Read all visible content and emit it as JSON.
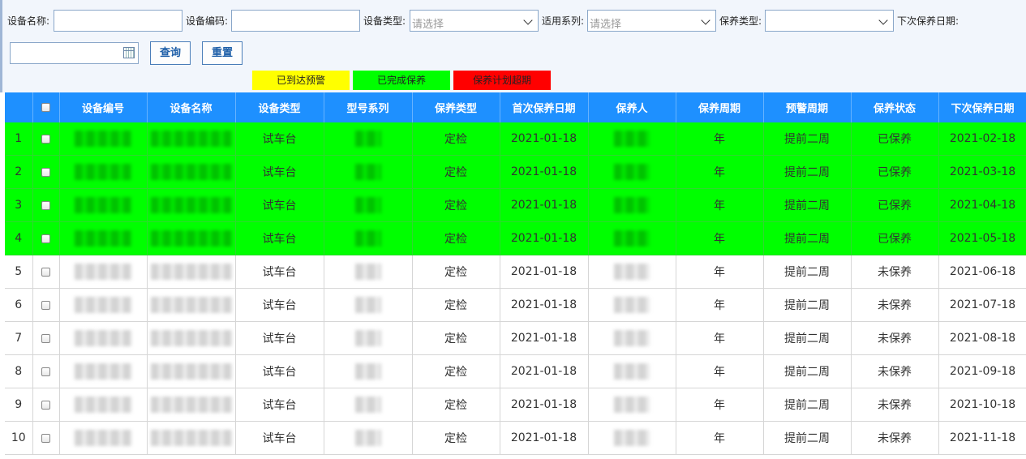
{
  "filters": {
    "device_name_label": "设备名称:",
    "device_code_label": "设备编码:",
    "device_type_label": "设备类型:",
    "device_type_placeholder": "请选择",
    "series_label": "适用系列:",
    "series_placeholder": "请选择",
    "maint_type_label": "保养类型:",
    "next_date_label": "下次保养日期:",
    "query_button": "查询",
    "reset_button": "重置"
  },
  "legend": [
    {
      "label": "已到达预警",
      "color": "#ffff00"
    },
    {
      "label": "已完成保养",
      "color": "#00ff00"
    },
    {
      "label": "保养计划超期",
      "color": "#ff0000"
    }
  ],
  "table": {
    "headers": [
      "设备编号",
      "设备名称",
      "设备类型",
      "型号系列",
      "保养类型",
      "首次保养日期",
      "保养人",
      "保养周期",
      "预警周期",
      "保养状态",
      "下次保养日期"
    ],
    "rows": [
      {
        "no": "1",
        "type": "试车台",
        "maint_type": "定检",
        "first_date": "2021-01-18",
        "cycle": "年",
        "warn": "提前二周",
        "status": "已保养",
        "next_date": "2021-02-18",
        "done": true
      },
      {
        "no": "2",
        "type": "试车台",
        "maint_type": "定检",
        "first_date": "2021-01-18",
        "cycle": "年",
        "warn": "提前二周",
        "status": "已保养",
        "next_date": "2021-03-18",
        "done": true
      },
      {
        "no": "3",
        "type": "试车台",
        "maint_type": "定检",
        "first_date": "2021-01-18",
        "cycle": "年",
        "warn": "提前二周",
        "status": "已保养",
        "next_date": "2021-04-18",
        "done": true
      },
      {
        "no": "4",
        "type": "试车台",
        "maint_type": "定检",
        "first_date": "2021-01-18",
        "cycle": "年",
        "warn": "提前二周",
        "status": "已保养",
        "next_date": "2021-05-18",
        "done": true
      },
      {
        "no": "5",
        "type": "试车台",
        "maint_type": "定检",
        "first_date": "2021-01-18",
        "cycle": "年",
        "warn": "提前二周",
        "status": "未保养",
        "next_date": "2021-06-18",
        "done": false
      },
      {
        "no": "6",
        "type": "试车台",
        "maint_type": "定检",
        "first_date": "2021-01-18",
        "cycle": "年",
        "warn": "提前二周",
        "status": "未保养",
        "next_date": "2021-07-18",
        "done": false
      },
      {
        "no": "7",
        "type": "试车台",
        "maint_type": "定检",
        "first_date": "2021-01-18",
        "cycle": "年",
        "warn": "提前二周",
        "status": "未保养",
        "next_date": "2021-08-18",
        "done": false
      },
      {
        "no": "8",
        "type": "试车台",
        "maint_type": "定检",
        "first_date": "2021-01-18",
        "cycle": "年",
        "warn": "提前二周",
        "status": "未保养",
        "next_date": "2021-09-18",
        "done": false
      },
      {
        "no": "9",
        "type": "试车台",
        "maint_type": "定检",
        "first_date": "2021-01-18",
        "cycle": "年",
        "warn": "提前二周",
        "status": "未保养",
        "next_date": "2021-10-18",
        "done": false
      },
      {
        "no": "10",
        "type": "试车台",
        "maint_type": "定检",
        "first_date": "2021-01-18",
        "cycle": "年",
        "warn": "提前二周",
        "status": "未保养",
        "next_date": "2021-11-18",
        "done": false
      }
    ]
  }
}
